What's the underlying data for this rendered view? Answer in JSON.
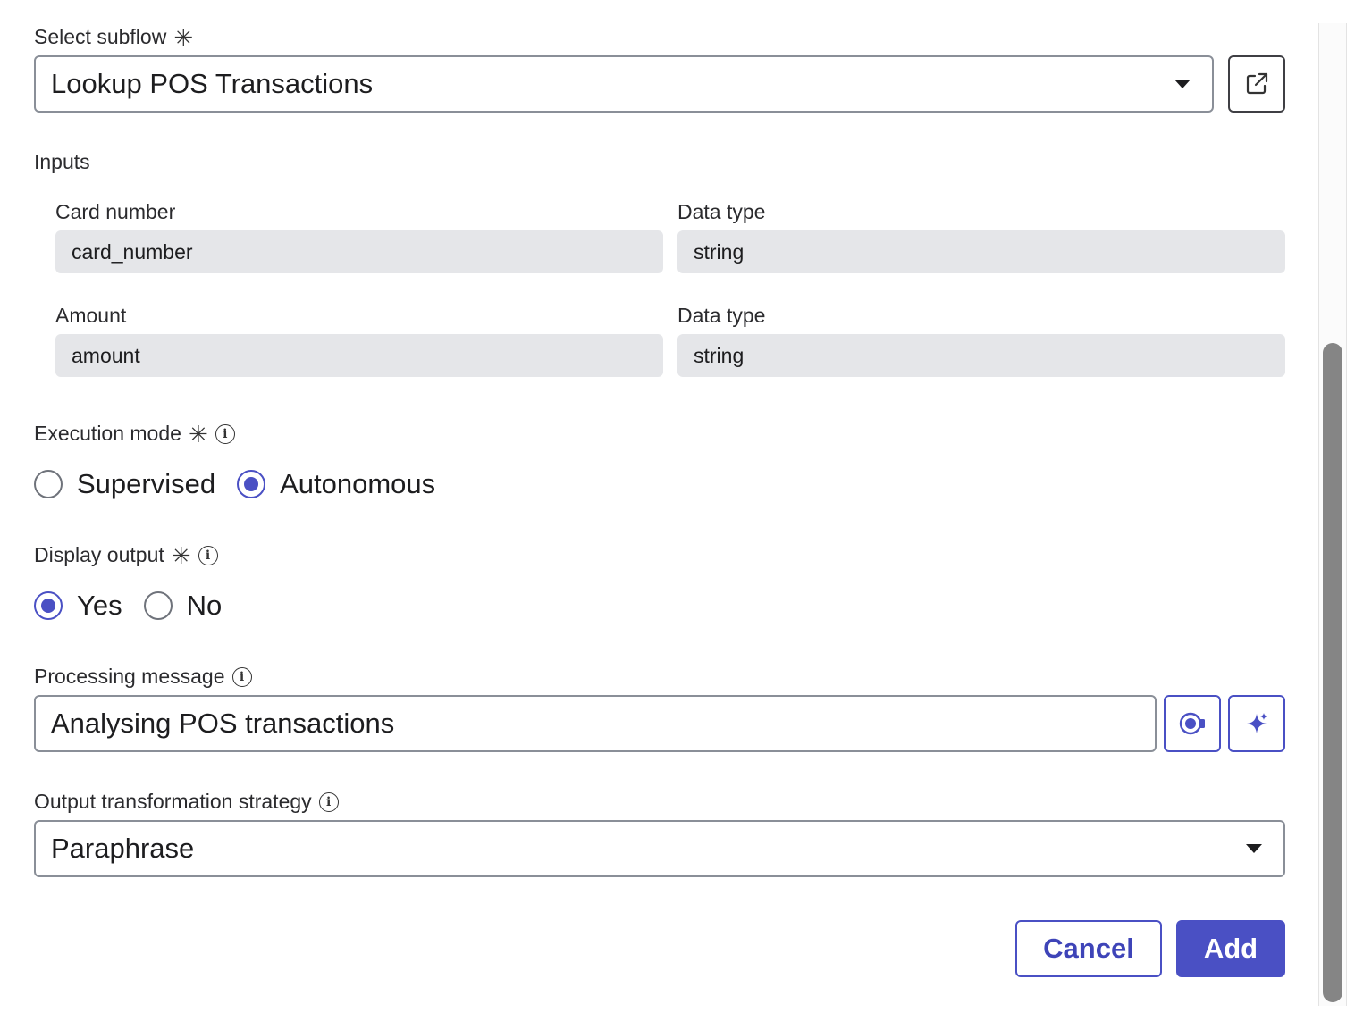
{
  "subflow": {
    "label": "Select subflow",
    "required_mark": "✳",
    "selected": "Lookup POS Transactions",
    "open_button_icon": "external-link-icon"
  },
  "inputs": {
    "section_label": "Inputs",
    "rows": [
      {
        "name_label": "Card number",
        "name_value": "card_number",
        "type_label": "Data type",
        "type_value": "string"
      },
      {
        "name_label": "Amount",
        "name_value": "amount",
        "type_label": "Data type",
        "type_value": "string"
      }
    ]
  },
  "execution_mode": {
    "label": "Execution mode",
    "required_mark": "✳",
    "info_icon": "info-icon",
    "options": [
      {
        "label": "Supervised",
        "checked": false
      },
      {
        "label": "Autonomous",
        "checked": true
      }
    ]
  },
  "display_output": {
    "label": "Display output",
    "required_mark": "✳",
    "info_icon": "info-icon",
    "options": [
      {
        "label": "Yes",
        "checked": true
      },
      {
        "label": "No",
        "checked": false
      }
    ]
  },
  "processing_message": {
    "label": "Processing message",
    "info_icon": "info-icon",
    "value": "Analysing POS transactions",
    "preview_icon": "preview-icon",
    "ai_icon": "sparkle-icon"
  },
  "output_strategy": {
    "label": "Output transformation strategy",
    "info_icon": "info-icon",
    "selected": "Paraphrase"
  },
  "actions": {
    "cancel_label": "Cancel",
    "add_label": "Add"
  },
  "colors": {
    "accent": "#4a50c4",
    "readonly_bg": "#e5e6e9",
    "scrollbar_thumb": "#858585"
  }
}
